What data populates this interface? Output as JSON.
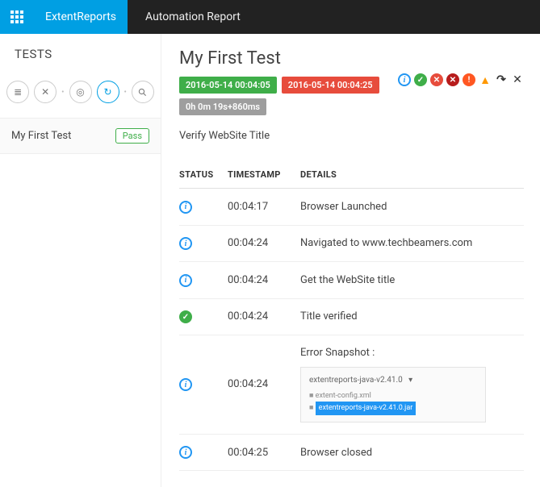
{
  "header": {
    "brand": "ExtentReports",
    "title": "Automation Report"
  },
  "sidebar": {
    "heading": "TESTS",
    "test": {
      "name": "My First Test",
      "status": "Pass"
    }
  },
  "details": {
    "title": "My First Test",
    "start": "2016-05-14 00:04:05",
    "end": "2016-05-14 00:04:25",
    "duration": "0h 0m 19s+860ms",
    "description": "Verify WebSite Title",
    "columns": {
      "status": "STATUS",
      "timestamp": "TIMESTAMP",
      "details": "DETAILS"
    },
    "snapshot_label": "Error Snapshot :",
    "snapshot_lines": {
      "l1": "extentreports-java-v2.41.0",
      "l2": "extent-config.xml",
      "l3": "extentreports-java-v2.41.0.jar"
    },
    "steps": [
      {
        "status": "info",
        "ts": "00:04:17",
        "text": "Browser Launched"
      },
      {
        "status": "info",
        "ts": "00:04:24",
        "text": "Navigated to www.techbeamers.com"
      },
      {
        "status": "info",
        "ts": "00:04:24",
        "text": "Get the WebSite title"
      },
      {
        "status": "pass",
        "ts": "00:04:24",
        "text": "Title verified"
      },
      {
        "status": "info",
        "ts": "00:04:24",
        "text": "__SNAPSHOT__"
      },
      {
        "status": "info",
        "ts": "00:04:25",
        "text": "Browser closed"
      }
    ]
  }
}
